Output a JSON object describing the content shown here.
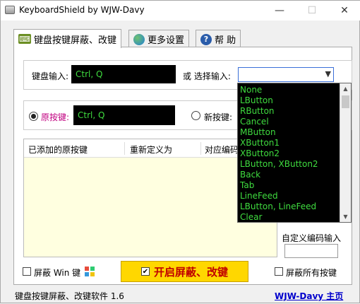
{
  "window": {
    "title": "KeyboardShield by WJW-Davy",
    "minimize": "—",
    "maximize": "☐",
    "close": "✕"
  },
  "tabs": [
    {
      "label": "键盘按键屏蔽、改键",
      "icon": "keyboard-icon"
    },
    {
      "label": "更多设置",
      "icon": "globe-icon"
    },
    {
      "label": "帮 助",
      "icon": "help-icon"
    }
  ],
  "keyboard_input": {
    "label": "键盘输入:",
    "value": "Ctrl, Q",
    "or_label": "或 选择输入:",
    "combo_value": ""
  },
  "original_key": {
    "label": "原按键:",
    "value": "Ctrl, Q",
    "new_label": "新按键:"
  },
  "table": {
    "columns": [
      "已添加的原按键",
      "重新定义为",
      "对应编码"
    ]
  },
  "dropdown": {
    "items": [
      "None",
      "LButton",
      "RButton",
      "Cancel",
      "MButton",
      "XButton1",
      "XButton2",
      "LButton, XButton2",
      "Back",
      "Tab",
      "LineFeed",
      "LButton, LineFeed",
      "Clear"
    ]
  },
  "custom_code": {
    "label": "自定义编码输入",
    "value": ""
  },
  "options": {
    "block_win_label": "屏蔽 Win 键",
    "start_label": "开启屏蔽、改键",
    "block_all_label": "屏蔽所有按键"
  },
  "status": {
    "version": "键盘按键屏蔽、改键软件 1.6",
    "homepage": "WJW-Davy 主页"
  },
  "colors": {
    "accent_green": "#3fdc3f",
    "start_bg": "#ffd700",
    "start_text": "#c00000",
    "original_key_label": "#c00080"
  }
}
